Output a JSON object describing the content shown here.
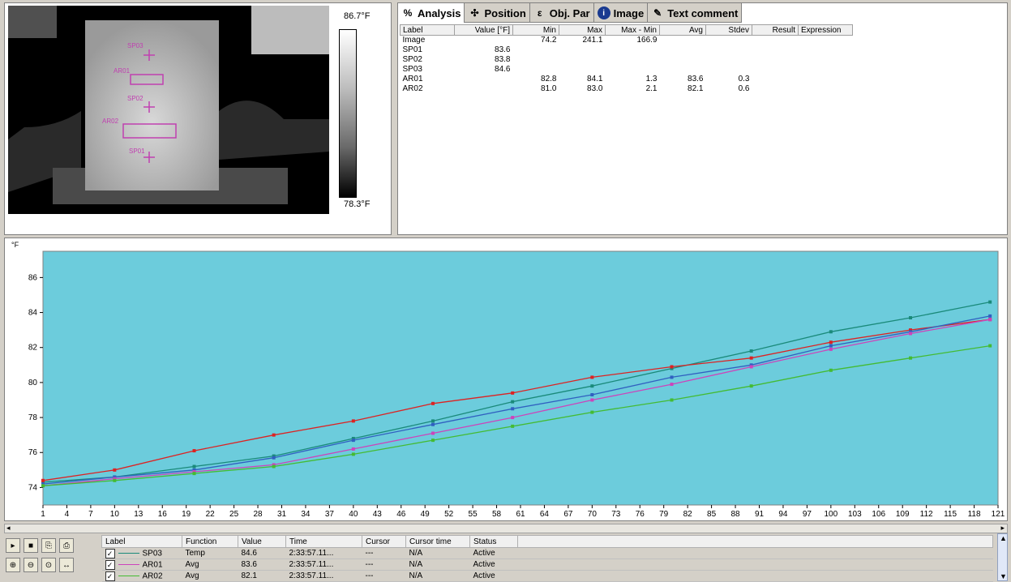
{
  "thermal": {
    "scale_max": "86.7°F",
    "scale_min": "78.3°F",
    "markers": [
      "SP03",
      "AR01",
      "SP02",
      "AR02",
      "SP01"
    ]
  },
  "analysis": {
    "tabs": [
      {
        "label": "Analysis",
        "icon": "analysis-icon"
      },
      {
        "label": "Position",
        "icon": "position-icon"
      },
      {
        "label": "Obj. Par",
        "icon": "object-parameters-icon"
      },
      {
        "label": "Image",
        "icon": "info-icon"
      },
      {
        "label": "Text comment",
        "icon": "text-comment-icon"
      }
    ],
    "columns": [
      "Label",
      "Value [°F]",
      "Min",
      "Max",
      "Max - Min",
      "Avg",
      "Stdev",
      "Result",
      "Expression"
    ],
    "rows": [
      [
        "Image",
        "",
        "74.2",
        "241.1",
        "166.9",
        "",
        "",
        "",
        ""
      ],
      [
        "SP01",
        "83.6",
        "",
        "",
        "",
        "",
        "",
        "",
        ""
      ],
      [
        "SP02",
        "83.8",
        "",
        "",
        "",
        "",
        "",
        "",
        ""
      ],
      [
        "SP03",
        "84.6",
        "",
        "",
        "",
        "",
        "",
        "",
        ""
      ],
      [
        "AR01",
        "",
        "82.8",
        "84.1",
        "1.3",
        "83.6",
        "0.3",
        "",
        ""
      ],
      [
        "AR02",
        "",
        "81.0",
        "83.0",
        "2.1",
        "82.1",
        "0.6",
        "",
        ""
      ]
    ]
  },
  "chart_data": {
    "type": "line",
    "ylabel": "°F",
    "ylim": [
      73,
      87.5
    ],
    "xlim": [
      1,
      121
    ],
    "xticks": [
      1,
      4,
      7,
      10,
      13,
      16,
      19,
      22,
      25,
      28,
      31,
      34,
      37,
      40,
      43,
      46,
      49,
      52,
      55,
      58,
      61,
      64,
      67,
      70,
      73,
      76,
      79,
      82,
      85,
      88,
      91,
      94,
      97,
      100,
      103,
      106,
      109,
      112,
      115,
      118,
      121
    ],
    "yticks": [
      74,
      76,
      78,
      80,
      82,
      84,
      86
    ],
    "grid": false,
    "background": "#6cccdc",
    "series": [
      {
        "name": "SP03",
        "color": "#1a8a7a",
        "x": [
          1,
          10,
          20,
          30,
          40,
          50,
          60,
          70,
          80,
          90,
          100,
          110,
          120
        ],
        "y": [
          74.3,
          74.6,
          75.2,
          75.8,
          76.8,
          77.8,
          78.9,
          79.8,
          80.8,
          81.8,
          82.9,
          83.7,
          84.6
        ]
      },
      {
        "name": "SP01",
        "color": "#dd2222",
        "x": [
          1,
          10,
          20,
          30,
          40,
          50,
          60,
          70,
          80,
          90,
          100,
          110,
          120
        ],
        "y": [
          74.4,
          75.0,
          76.1,
          77.0,
          77.8,
          78.8,
          79.4,
          80.3,
          80.9,
          81.4,
          82.3,
          83.0,
          83.6
        ]
      },
      {
        "name": "SP02",
        "color": "#3060c0",
        "x": [
          1,
          10,
          20,
          30,
          40,
          50,
          60,
          70,
          80,
          90,
          100,
          110,
          120
        ],
        "y": [
          74.2,
          74.6,
          75.0,
          75.7,
          76.7,
          77.6,
          78.5,
          79.3,
          80.3,
          81.0,
          82.1,
          82.9,
          83.8
        ]
      },
      {
        "name": "AR01",
        "color": "#cc44bb",
        "x": [
          1,
          10,
          20,
          30,
          40,
          50,
          60,
          70,
          80,
          90,
          100,
          110,
          120
        ],
        "y": [
          74.1,
          74.5,
          74.9,
          75.3,
          76.2,
          77.1,
          78.0,
          79.0,
          79.9,
          80.9,
          81.9,
          82.8,
          83.6
        ]
      },
      {
        "name": "AR02",
        "color": "#44bb33",
        "x": [
          1,
          10,
          20,
          30,
          40,
          50,
          60,
          70,
          80,
          90,
          100,
          110,
          120
        ],
        "y": [
          74.1,
          74.4,
          74.8,
          75.2,
          75.9,
          76.7,
          77.5,
          78.3,
          79.0,
          79.8,
          80.7,
          81.4,
          82.1
        ]
      }
    ]
  },
  "legend": {
    "columns": [
      "Label",
      "Function",
      "Value",
      "Time",
      "Cursor",
      "Cursor time",
      "Status"
    ],
    "rows": [
      {
        "label": "SP03",
        "function": "Temp",
        "value": "84.6",
        "time": "2:33:57.11...",
        "cursor": "---",
        "cursor_time": "N/A",
        "status": "Active",
        "color": "#1a8a7a"
      },
      {
        "label": "AR01",
        "function": "Avg",
        "value": "83.6",
        "time": "2:33:57.11...",
        "cursor": "---",
        "cursor_time": "N/A",
        "status": "Active",
        "color": "#cc44bb"
      },
      {
        "label": "AR02",
        "function": "Avg",
        "value": "82.1",
        "time": "2:33:57.11...",
        "cursor": "---",
        "cursor_time": "N/A",
        "status": "Active",
        "color": "#44bb33"
      }
    ]
  }
}
